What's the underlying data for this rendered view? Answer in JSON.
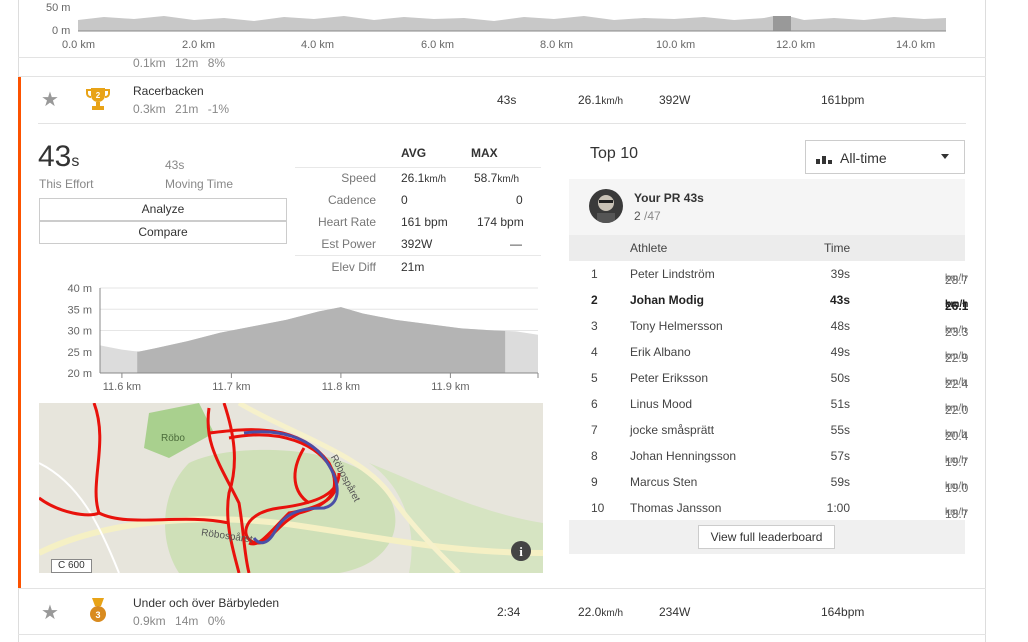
{
  "top_chart": {
    "y_ticks": [
      "50 m",
      "0 m"
    ],
    "x_ticks": [
      "0.0 km",
      "2.0 km",
      "4.0 km",
      "6.0 km",
      "8.0 km",
      "10.0 km",
      "12.0 km",
      "14.0 km"
    ]
  },
  "prev_segment": {
    "distance": "0.1km",
    "elev": "12m",
    "grade": "8%"
  },
  "segment": {
    "name": "Racerbacken",
    "distance": "0.3km",
    "elev": "21m",
    "grade": "-1%",
    "medal": "2",
    "time": "43s",
    "speed_val": "26.1",
    "speed_unit": "km/h",
    "power": "392W",
    "hr": "161bpm"
  },
  "effort": {
    "big_num": "43",
    "big_unit": "s",
    "this_effort_label": "This Effort",
    "moving_time_val": "43s",
    "moving_time_label": "Moving Time",
    "analyze_label": "Analyze",
    "compare_label": "Compare"
  },
  "stats": {
    "avg_header": "AVG",
    "max_header": "MAX",
    "rows": [
      {
        "label": "Speed",
        "avg": "26.1",
        "avg_unit": "km/h",
        "max": "58.7",
        "max_unit": "km/h"
      },
      {
        "label": "Cadence",
        "avg": "0",
        "avg_unit": "",
        "max": "0",
        "max_unit": ""
      },
      {
        "label": "Heart Rate",
        "avg": "161 bpm",
        "avg_unit": "",
        "max": "174 bpm",
        "max_unit": ""
      },
      {
        "label": "Est Power",
        "avg": "392W",
        "avg_unit": "",
        "max": "—",
        "max_unit": ""
      },
      {
        "label": "Elev Diff",
        "avg": "21m",
        "avg_unit": "",
        "max": "",
        "max_unit": ""
      }
    ]
  },
  "chart_data": {
    "type": "area",
    "y_ticks": [
      "40 m",
      "35 m",
      "30 m",
      "25 m",
      "20 m"
    ],
    "x_ticks": [
      "11.6 km",
      "11.7 km",
      "11.8 km",
      "11.9 km"
    ],
    "ylim": [
      20,
      40
    ],
    "xlim": [
      11.58,
      11.98
    ],
    "x": [
      11.58,
      11.6,
      11.615,
      11.63,
      11.66,
      11.69,
      11.72,
      11.75,
      11.78,
      11.8,
      11.82,
      11.85,
      11.88,
      11.91,
      11.94,
      11.96,
      11.98
    ],
    "values": [
      26.5,
      25.5,
      25,
      25.8,
      27.5,
      29.5,
      31,
      32.5,
      34.5,
      35.5,
      34,
      32.5,
      31.5,
      30.5,
      30,
      29.8,
      29
    ],
    "highlight_range": [
      11.614,
      11.95
    ],
    "grid": true
  },
  "map": {
    "place_label": "Röbo",
    "road_label_1": "Röbospåret",
    "road_label_2": "Röbospåret",
    "road_sign": "C 600",
    "info_icon": "info-icon"
  },
  "leaderboard": {
    "title": "Top 10",
    "filter_label": "All-time",
    "pr_label": "Your PR 43s",
    "pr_rank": "2",
    "pr_total": "/47",
    "col_athlete": "Athlete",
    "col_time": "Time",
    "rows": [
      {
        "rank": "1",
        "name": "Peter Lindström",
        "time": "39s",
        "speed": "28.7",
        "unit": "km/h",
        "me": false
      },
      {
        "rank": "2",
        "name": "Johan Modig",
        "time": "43s",
        "speed": "26.1",
        "unit": "km/h",
        "me": true
      },
      {
        "rank": "3",
        "name": "Tony Helmersson",
        "time": "48s",
        "speed": "23.3",
        "unit": "km/h",
        "me": false
      },
      {
        "rank": "4",
        "name": "Erik Albano",
        "time": "49s",
        "speed": "22.9",
        "unit": "km/h",
        "me": false
      },
      {
        "rank": "5",
        "name": "Peter Eriksson",
        "time": "50s",
        "speed": "22.4",
        "unit": "km/h",
        "me": false
      },
      {
        "rank": "6",
        "name": "Linus Mood",
        "time": "51s",
        "speed": "22.0",
        "unit": "km/h",
        "me": false
      },
      {
        "rank": "7",
        "name": "jocke småsprätt",
        "time": "55s",
        "speed": "20.4",
        "unit": "km/h",
        "me": false
      },
      {
        "rank": "8",
        "name": "Johan Henningsson",
        "time": "57s",
        "speed": "19.7",
        "unit": "km/h",
        "me": false
      },
      {
        "rank": "9",
        "name": "Marcus Sten",
        "time": "59s",
        "speed": "19.0",
        "unit": "km/h",
        "me": false
      },
      {
        "rank": "10",
        "name": "Thomas Jansson",
        "time": "1:00",
        "speed": "18.7",
        "unit": "km/h",
        "me": false
      }
    ],
    "view_full_label": "View full leaderboard"
  },
  "next_segment": {
    "name": "Under och över Bärbyleden",
    "distance": "0.9km",
    "elev": "14m",
    "grade": "0%",
    "medal": "3",
    "time": "2:34",
    "speed_val": "22.0",
    "speed_unit": "km/h",
    "power": "234W",
    "hr": "164bpm"
  },
  "colors": {
    "accent": "#fc5200",
    "route_red": "#e8120c",
    "route_blue": "#4a4fa6",
    "medal_gold": "#e8a317",
    "medal_bronze": "#d98b1f",
    "chart_gray": "#b4b4b4"
  }
}
